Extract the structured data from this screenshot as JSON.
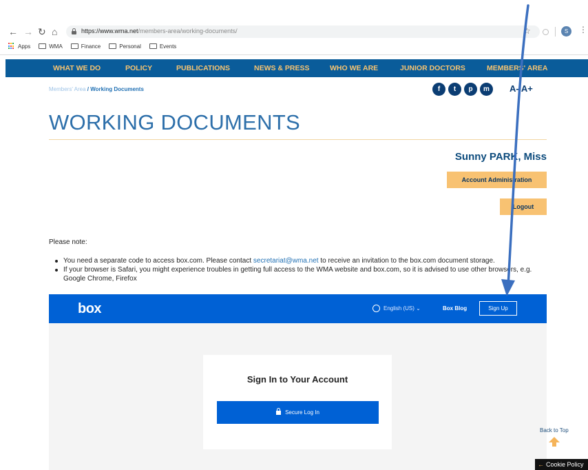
{
  "browser": {
    "url_domain": "https://www.wma.net",
    "url_path": "/members-area/working-documents/",
    "avatar_letter": "S",
    "bookmarks": [
      "Apps",
      "WMA",
      "Finance",
      "Personal",
      "Events"
    ]
  },
  "nav": {
    "items": [
      "WHAT WE DO",
      "POLICY",
      "PUBLICATIONS",
      "NEWS & PRESS",
      "WHO WE ARE",
      "JUNIOR DOCTORS",
      "MEMBERS' AREA"
    ]
  },
  "breadcrumb": {
    "parent": "Members' Area",
    "separator": "/",
    "current": "Working Documents"
  },
  "socials": [
    "f",
    "t",
    "p",
    "m"
  ],
  "font_size_controls": "A- A+",
  "page": {
    "title": "WORKING DOCUMENTS",
    "user_name": "Sunny PARK, Miss",
    "account_button": "Account Administration",
    "logout_button": "Logout",
    "note_heading": "Please note:",
    "bullet1_pre": "You need a separate code to access box.com. Please contact ",
    "bullet1_link": "secretariat@wma.net",
    "bullet1_post": " to receive an invitation to the box.com document storage.",
    "bullet2": "If your browser is Safari, you might experience troubles in getting full access to the WMA website and box.com, so it is advised to use other browsers, e.g. Google Chrome, Firefox"
  },
  "box": {
    "logo": "box",
    "language": "English (US) ⌄",
    "blog": "Box Blog",
    "signup": "Sign Up",
    "card_title": "Sign In to Your Account",
    "secure_login": "Secure Log In"
  },
  "footer": {
    "back_to_top": "Back to Top",
    "cookie_policy": "Cookie Policy"
  },
  "colors": {
    "nav_bg": "#0a5c9a",
    "nav_text": "#f7c471",
    "accent_button": "#f8c272",
    "box_blue": "#0061d5",
    "annotation_arrow": "#3b6fbf"
  }
}
